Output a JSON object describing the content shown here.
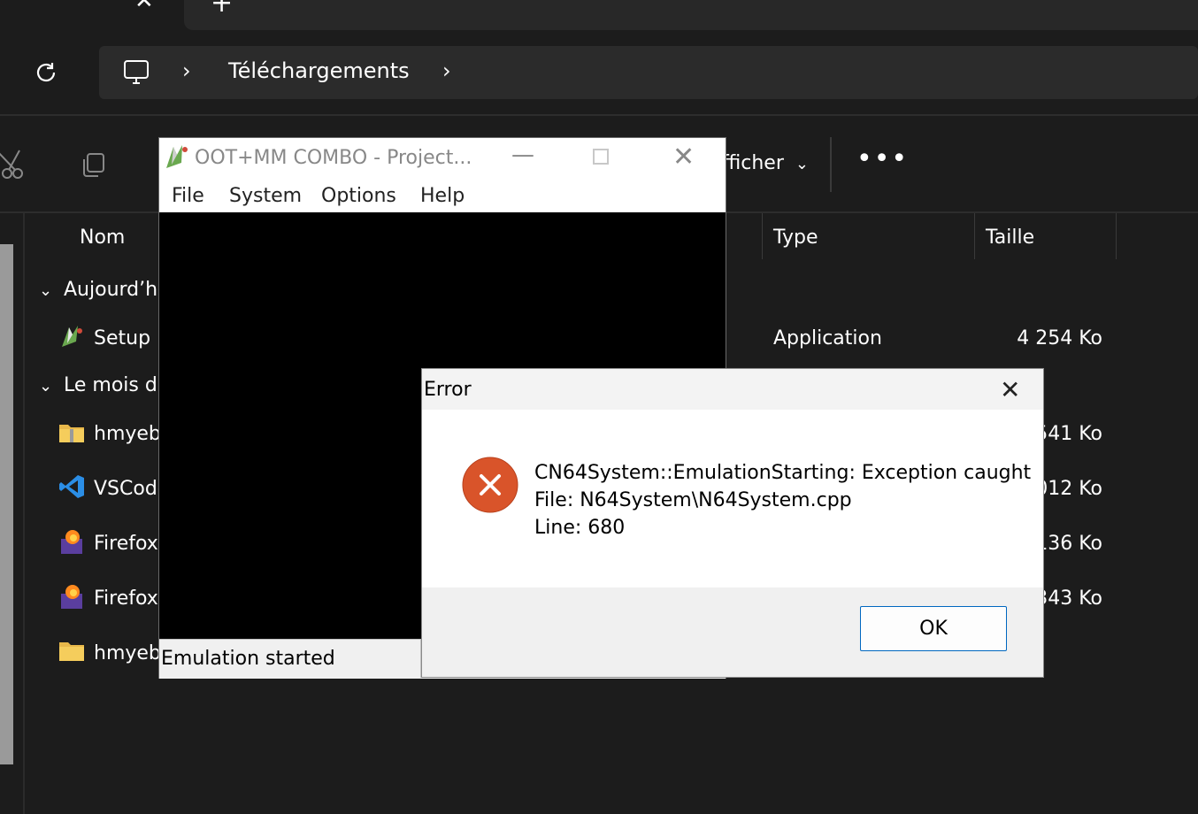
{
  "explorer": {
    "tab_close_glyph": "✕",
    "tab_new_glyph": "+",
    "breadcrumb": {
      "separator": "›",
      "current": "Téléchargements"
    },
    "toolbar": {
      "view_label": "fficher",
      "view_chevron": "⌄",
      "more_label": "•••"
    },
    "columns": {
      "name": "Nom",
      "type": "Type",
      "size": "Taille"
    },
    "groups": [
      {
        "label": "Aujourd’hu",
        "chevron": "⌄"
      },
      {
        "label": "Le mois de",
        "chevron": "⌄"
      }
    ],
    "rows": [
      {
        "name": "Setup F",
        "type": "Application",
        "size": "4 254 Ko",
        "icon": "project64-icon"
      },
      {
        "name": "hmyeb",
        "type": "",
        "size": "541 Ko",
        "icon": "zip-folder-icon"
      },
      {
        "name": "VSCode",
        "type": "",
        "size": "012 Ko",
        "icon": "vscode-icon"
      },
      {
        "name": "Firefox",
        "type": "",
        "size": "136 Ko",
        "icon": "firefox-installer-icon"
      },
      {
        "name": "Firefox",
        "type": "",
        "size": "343 Ko",
        "icon": "firefox-installer-icon"
      },
      {
        "name": "hmyeb",
        "type": "",
        "size": "",
        "icon": "folder-icon"
      }
    ]
  },
  "emulator": {
    "title": "OOT+MM COMBO - Project...",
    "min_glyph": "—",
    "close_glyph": "✕",
    "menu": [
      "File",
      "System",
      "Options",
      "Help"
    ],
    "status": "Emulation started"
  },
  "error_dialog": {
    "title": "Error",
    "close_glyph": "✕",
    "message_lines": [
      "CN64System::EmulationStarting: Exception caught",
      "File: N64System\\N64System.cpp",
      "Line: 680"
    ],
    "ok_label": "OK",
    "icon": "error-icon",
    "colors": {
      "error_icon": "#d9542a",
      "ok_border": "#0067c0"
    }
  }
}
